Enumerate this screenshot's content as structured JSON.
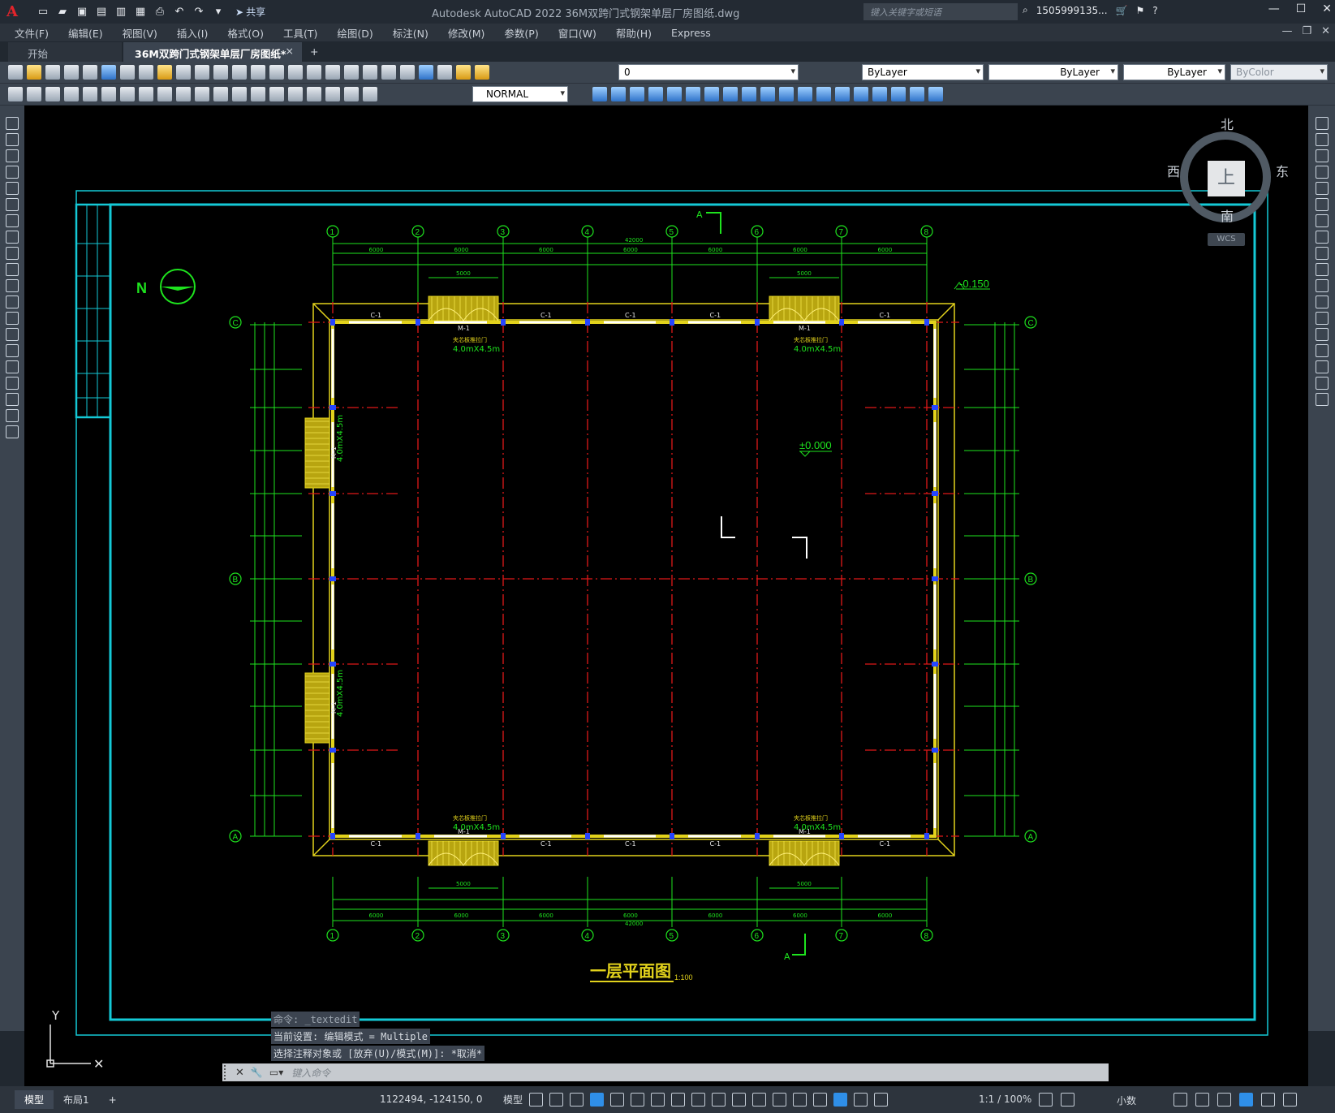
{
  "app": {
    "logo": "A",
    "title": "Autodesk AutoCAD 2022    36M双跨门式钢架单层厂房图纸.dwg",
    "share_label": "共享",
    "search_placeholder": "键入关键字或短语",
    "user": "1505999135...",
    "accent_color": "#2f8fe8"
  },
  "menu": [
    "文件(F)",
    "编辑(E)",
    "视图(V)",
    "插入(I)",
    "格式(O)",
    "工具(T)",
    "绘图(D)",
    "标注(N)",
    "修改(M)",
    "参数(P)",
    "窗口(W)",
    "帮助(H)",
    "Express"
  ],
  "tabs": {
    "start": "开始",
    "active": "36M双跨门式钢架单层厂房图纸*",
    "close": "×",
    "add": "+"
  },
  "toolbar": {
    "layer": "0",
    "color": "ByLayer",
    "linetype": "ByLayer",
    "lineweight": "ByLayer",
    "plotstyle": "ByColor",
    "dimstyle": "NORMAL"
  },
  "viewcube": {
    "north": "北",
    "south": "南",
    "west": "西",
    "east": "东",
    "top": "上",
    "wcs": "WCS"
  },
  "drawing": {
    "north_label": "N",
    "title": "一层平面图",
    "scale": "1:100",
    "elev_top": "-0.150",
    "elev_floor": "±0.000",
    "section_mark": "A",
    "grid_cols": [
      "1",
      "2",
      "3",
      "4",
      "5",
      "6",
      "7",
      "8"
    ],
    "grid_rows": [
      "C",
      "B",
      "A"
    ],
    "total_dim": "42000",
    "span_dims": [
      "6000",
      "6000",
      "6000",
      "6000",
      "6000",
      "6000",
      "6000"
    ],
    "door_label": "4.0mX4.5m",
    "door_tag": "M-1",
    "door_note": "夹芯板推拉门",
    "window_tag": "C-1",
    "door_width": "5000"
  },
  "command": {
    "history": [
      "命令: _textedit",
      "当前设置: 编辑模式 = Multiple",
      "选择注释对象或 [放弃(U)/模式(M)]: *取消*"
    ],
    "placeholder": "键入命令"
  },
  "status": {
    "model_tab": "模型",
    "layout_tab": "布局1",
    "add_tab": "+",
    "coords": "1122494, -124150, 0",
    "model": "模型",
    "anno_scale": "1:1 / 100%",
    "units": "小数"
  }
}
